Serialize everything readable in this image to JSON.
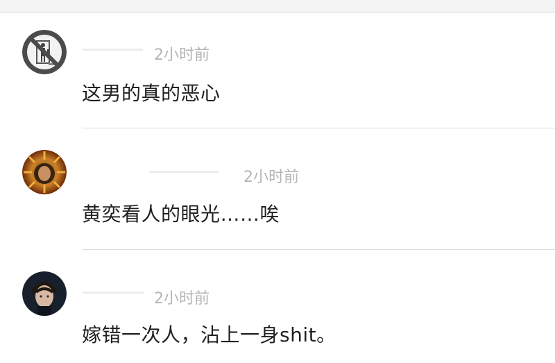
{
  "comments": [
    {
      "avatar": "no-entry-sign-icon",
      "time": "2小时前",
      "text": "这男的真的恶心"
    },
    {
      "avatar": "sunburst-portrait-avatar",
      "time": "2小时前",
      "text": "黄奕看人的眼光……唉"
    },
    {
      "avatar": "man-portrait-avatar",
      "time": "2小时前",
      "text": "嫁错一次人，沾上一身shit。"
    }
  ],
  "colors": {
    "timestamp": "#b5b5b5",
    "text": "#202020",
    "divider": "#dcdcdc"
  }
}
